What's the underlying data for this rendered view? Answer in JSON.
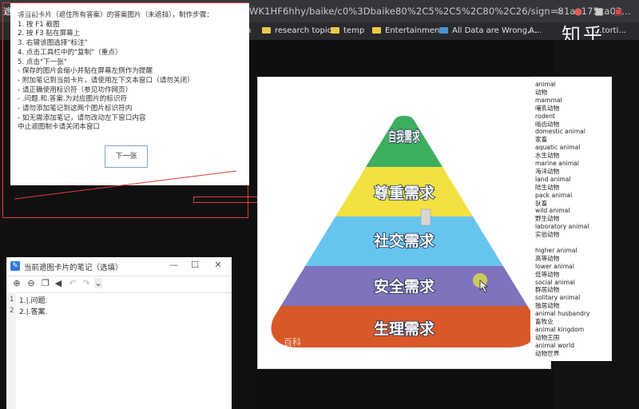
{
  "browser": {
    "url": "WK1HF6hhy/baike/c0%3Dbaike80%2C5%2C5%2C80%2C26/sign=81aa175ca03...",
    "bookmarks": [
      "research topics",
      "temp",
      "Entertainment",
      "All Data are Wrong,...",
      "A..."
    ],
    "bookmark_partial_left": "n",
    "partial_right": "...torti..."
  },
  "site_logo": "知乎",
  "card": {
    "title": "遮图卡片",
    "steps": [
      "将当前卡片（遮住所有答案）的答案图片（未遮挡），制作步骤：",
      "1. 按 F1 截图",
      "2. 按 F3 贴在屏幕上",
      "3. 右键该图选择\"标注\"",
      "4. 点击工具栏中的\"复制\"（重点）",
      "5. 点击\"下一张\"",
      "- 保存的图片会缩小并贴在屏幕左侧作为提醒",
      "- 附加笔记到当前卡片，请使用左下文本窗口（请勿关闭）",
      "- 请正确使用标识符（参见功作网页）",
      "- .问题.和.答案.为对应图片的标识符",
      "- 请勿添加笔记到这两个图片标识符内",
      "- 如无需添加笔记，请勿改动左下窗口内容",
      "中止遮图制卡请关闭本窗口"
    ],
    "next_button": "下一张"
  },
  "notes_window": {
    "title": "当前遮图卡片的笔记（选填）",
    "lines": [
      {
        "num": "1",
        "text": "1.|.问题."
      },
      {
        "num": "2",
        "text": "2.|.答案."
      }
    ],
    "toolbar_icons": [
      "zoom-in-icon",
      "zoom-out-icon",
      "copy-icon",
      "speaker-icon",
      "undo-icon",
      "redo-icon",
      "more-icon"
    ]
  },
  "pyramid": {
    "levels": [
      {
        "label": "自我需求",
        "color": "#3dae5e"
      },
      {
        "label": "尊重需求",
        "color": "#f2e141"
      },
      {
        "label": "社交需求",
        "color": "#66c5ef"
      },
      {
        "label": "安全需求",
        "color": "#7f73bd"
      },
      {
        "label": "生理需求",
        "color": "#d8582a"
      }
    ],
    "watermark": "百科"
  },
  "word_list": [
    "animal",
    "动物",
    "mammal",
    "哺乳动物",
    "rodent",
    "啮齿动物",
    "domestic animal",
    "家畜",
    "aquatic animal",
    "水生动物",
    "marine animal",
    "海洋动物",
    "land animal",
    "陆生动物",
    "pack animal",
    "驮畜",
    "wild animal",
    "野生动物",
    "laboratory animal",
    "实验动物",
    "",
    "higher animal",
    "高等动物",
    "lower animal",
    "低等动物",
    "social animal",
    "群居动物",
    "solitary animal",
    "独居动物",
    "animal husbandry",
    "畜牧业",
    "animal kingdom",
    "动物王国",
    "animal world",
    "动物世界"
  ]
}
